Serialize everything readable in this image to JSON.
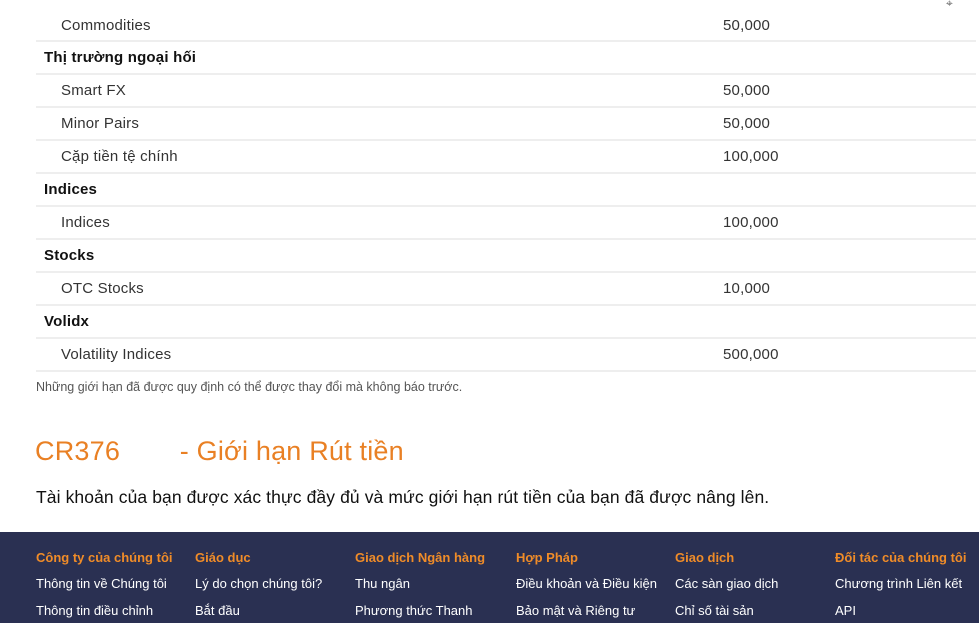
{
  "limits": [
    {
      "type": "item",
      "name": "Commodities",
      "value": "50,000"
    },
    {
      "type": "group",
      "name": "Thị trường ngoại hối"
    },
    {
      "type": "item",
      "name": "Smart FX",
      "value": "50,000"
    },
    {
      "type": "item",
      "name": "Minor Pairs",
      "value": "50,000"
    },
    {
      "type": "item",
      "name": "Cặp tiền tệ chính",
      "value": "100,000"
    },
    {
      "type": "group",
      "name": "Indices"
    },
    {
      "type": "item",
      "name": "Indices",
      "value": "100,000"
    },
    {
      "type": "group",
      "name": "Stocks"
    },
    {
      "type": "item",
      "name": "OTC Stocks",
      "value": "10,000"
    },
    {
      "type": "group",
      "name": "Volidx"
    },
    {
      "type": "item",
      "name": "Volatility Indices",
      "value": "500,000"
    }
  ],
  "note": "Những giới hạn đã được quy định có thể được thay đổi mà không báo trước.",
  "withdrawal": {
    "title_prefix": "CR376",
    "title_suffix": " - Giới hạn Rút tiền",
    "description": "Tài khoản của bạn được xác thực đầy đủ và mức giới hạn rút tiền của bạn đã được nâng lên."
  },
  "footer": {
    "columns": [
      {
        "title": "Công ty của chúng tôi",
        "links": [
          "Thông tin về Chúng tôi",
          "Thông tin điều chỉnh"
        ]
      },
      {
        "title": "Giáo dục",
        "links": [
          "Lý do chọn chúng tôi?",
          "Bắt đầu"
        ]
      },
      {
        "title": "Giao dịch Ngân hàng",
        "links": [
          "Thu ngân",
          "Phương thức Thanh"
        ]
      },
      {
        "title": "Hợp Pháp",
        "links": [
          "Điều khoản và Điều kiện",
          "Bảo mật và Riêng tư"
        ]
      },
      {
        "title": "Giao dịch",
        "links": [
          "Các sàn giao dịch",
          "Chỉ số tài sản"
        ]
      },
      {
        "title": "Đối tác của chúng tôi",
        "links": [
          "Chương trình Liên kết",
          "API"
        ]
      }
    ]
  },
  "colors": {
    "accent": "#e98024",
    "footer_bg": "#2a3052",
    "footer_heading": "#f08c28"
  }
}
